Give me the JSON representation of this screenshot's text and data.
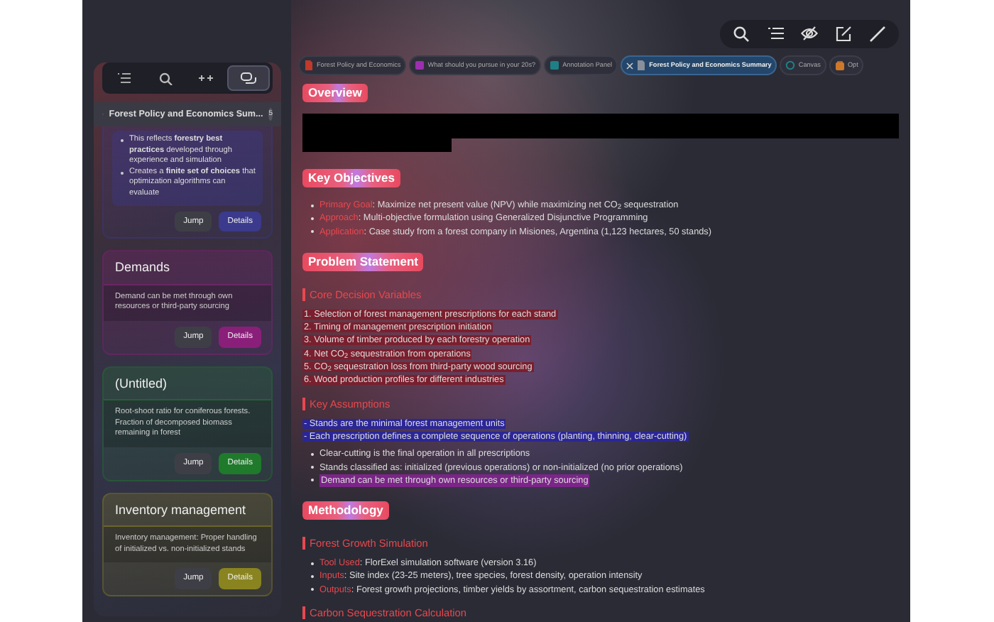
{
  "sidebar": {
    "tool_tabs": [
      {
        "selected": false
      },
      {
        "selected": false
      },
      {
        "selected": false
      },
      {
        "selected": true
      }
    ],
    "document": {
      "title": "Forest Policy and Economics Sum...",
      "count": "5"
    },
    "cards": [
      {
        "color": "#3b3a8c",
        "bullets": [
          "This reflects **forestry best practices** developed through experience and simulation",
          "Creates a **finite set of choices** that optimization algorithms can evaluate"
        ],
        "jump": "Jump",
        "details": "Details"
      },
      {
        "color": "#8a1f7a",
        "title": "Demands",
        "body": "Demand can be met through own resources or third-party sourcing",
        "jump": "Jump",
        "details": "Details"
      },
      {
        "color": "#1f7a2c",
        "title": "(Untitled)",
        "body": "Root-shoot ratio for coniferous forests. Fraction of decomposed biomass remaining in forest",
        "jump": "Jump",
        "details": "Details"
      },
      {
        "color": "#8a8420",
        "title": "Inventory management",
        "body": "Inventory management: Proper handling of initialized vs. non-initialized stands",
        "jump": "Jump",
        "details": "Details"
      }
    ]
  },
  "tabs": [
    {
      "label": "Forest Policy and Economics",
      "selected": false,
      "kind": "doc",
      "color": "#c0392b"
    },
    {
      "label": "What should you pursue in your 20s?",
      "selected": false,
      "kind": "square",
      "color": "#9b2fae"
    },
    {
      "label": "Annotation Panel",
      "selected": false,
      "kind": "square",
      "color": "#1f7f86"
    },
    {
      "label": "Forest Policy and Economics Summary",
      "selected": true,
      "kind": "doc",
      "color": "#8a8f99"
    },
    {
      "label": "Canvas",
      "selected": false,
      "kind": "canvas",
      "color": "#1f7f86"
    },
    {
      "label": "Opt",
      "selected": false,
      "kind": "bag",
      "color": "#d0782a"
    }
  ],
  "sections": [
    {
      "heading": "Overview",
      "blocks": [
        {
          "kind": "redacted"
        }
      ]
    },
    {
      "heading": "Key Objectives",
      "blocks": [
        {
          "kind": "bullets",
          "items": [
            {
              "label": "Primary Goal",
              "text": ": Maximize net present value (NPV) while maximizing net CO$_{2}$ sequestration"
            },
            {
              "label": "Approach",
              "text": ": Multi-objective formulation using Generalized Disjunctive Programming"
            },
            {
              "label": "Application",
              "text": ": Case study from a forest company in Misiones, Argentina (1,123 hectares, 50 stands)"
            }
          ]
        }
      ]
    },
    {
      "heading": "Problem Statement",
      "blocks": [
        {
          "kind": "subheading",
          "text": "Core Decision Variables"
        },
        {
          "kind": "lines",
          "items": [
            {
              "text": "1. Selection of forest management prescriptions for each stand",
              "color": "#7a1f2e"
            },
            {
              "text": "2. Timing of management prescription initiation",
              "color": "#7a1f2e"
            },
            {
              "text": "3. Volume of timber produced by each forestry operation",
              "color": "#7a1f2e"
            },
            {
              "text": "4. Net CO$_{2}$ sequestration from operations",
              "color": "#7a1f2e"
            },
            {
              "text": "5. CO$_{2}$ sequestration loss from third-party wood sourcing",
              "color": "#7a1f2e"
            },
            {
              "text": "6. Wood production profiles for different industries",
              "color": "#7a1f2e"
            }
          ]
        },
        {
          "kind": "subheading",
          "text": "Key Assumptions"
        },
        {
          "kind": "lines",
          "items": [
            {
              "text": "- Stands are the minimal forest management units",
              "color": "#2b2696"
            },
            {
              "text": "- Each prescription defines a complete sequence of operations (planting, thinning, clear-cutting)",
              "color": "#2b2696"
            }
          ]
        },
        {
          "kind": "bullets",
          "items": [
            {
              "text": "Clear-cutting is the final operation in all prescriptions"
            },
            {
              "text": "Stands classified as: initialized (previous operations) or non-initialized (no prior operations)"
            },
            {
              "text": "Demand can be met through own resources or third-party sourcing",
              "color": "#7b2588"
            }
          ]
        }
      ]
    },
    {
      "heading": "Methodology",
      "blocks": [
        {
          "kind": "subheading",
          "text": "Forest Growth Simulation"
        },
        {
          "kind": "bullets",
          "items": [
            {
              "label": "Tool Used",
              "text": ": FlorExel simulation software (version 3.16)"
            },
            {
              "label": "Inputs",
              "text": ": Site index (23-25 meters), tree species, forest density, operation intensity"
            },
            {
              "label": "Outputs",
              "text": ": Forest growth projections, timber yields by assortment, carbon sequestration estimates"
            }
          ]
        },
        {
          "kind": "subheading",
          "text": "Carbon Sequestration Calculation"
        }
      ]
    }
  ]
}
